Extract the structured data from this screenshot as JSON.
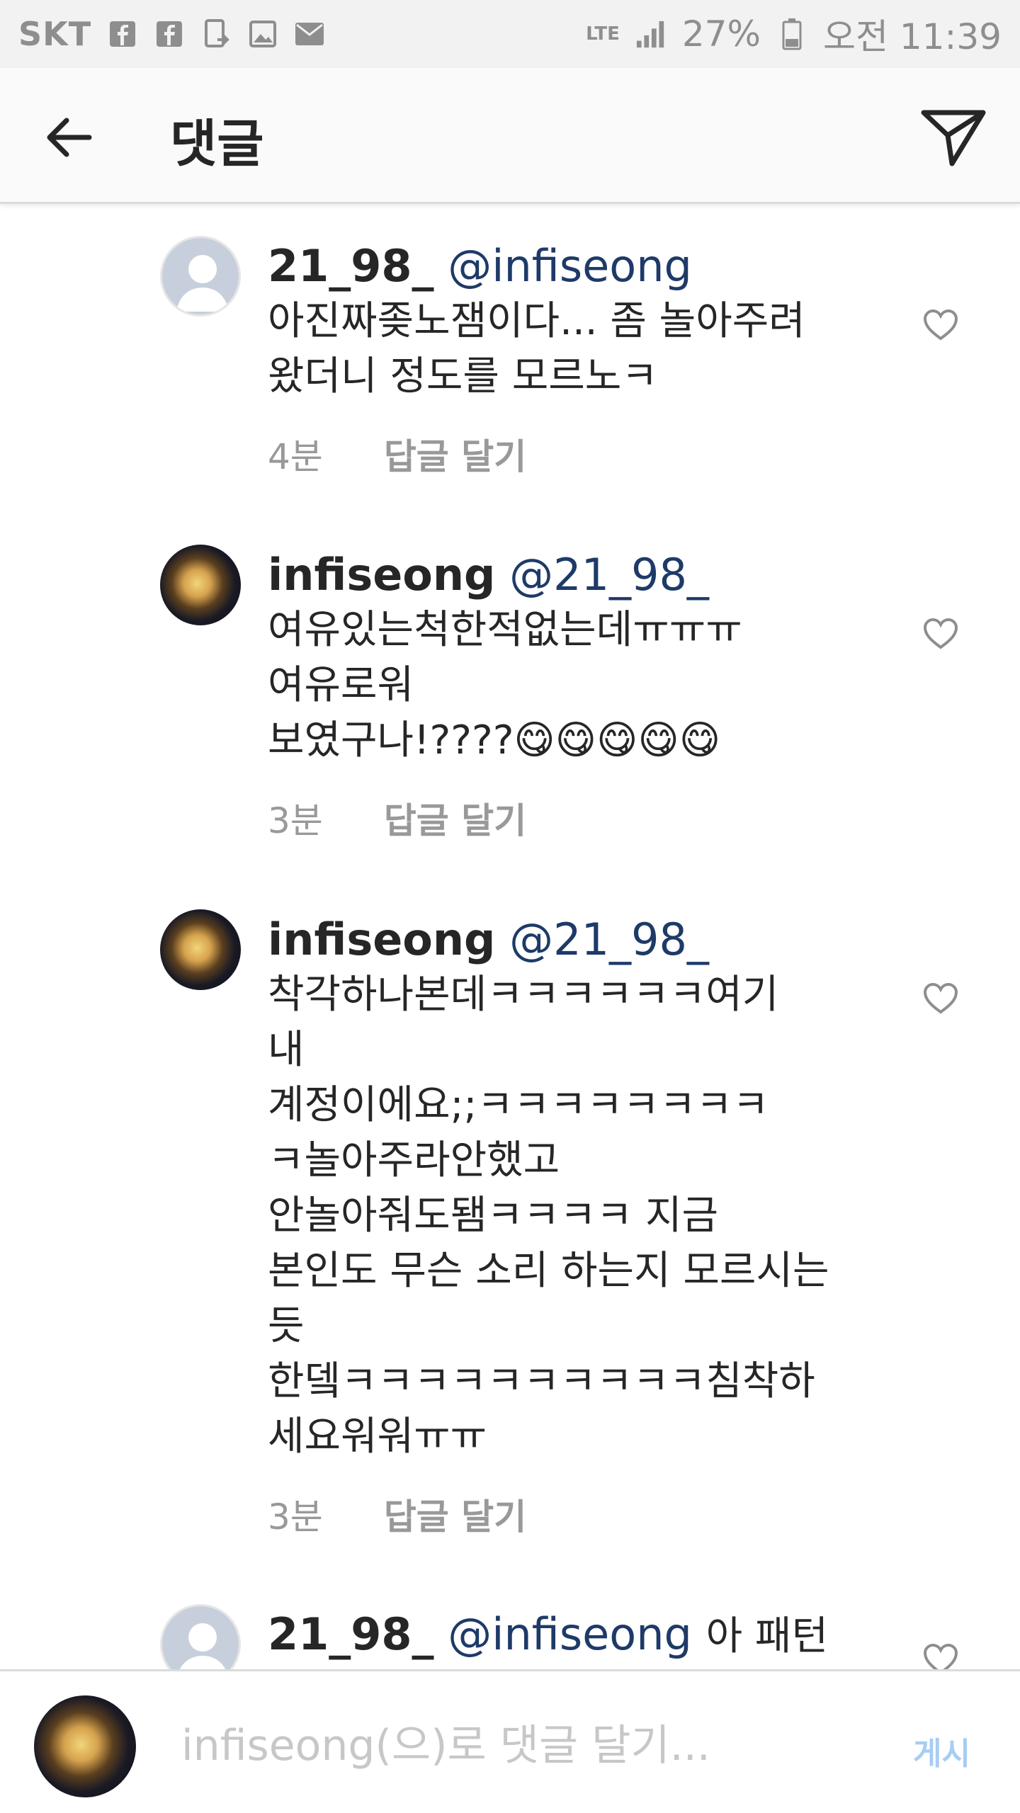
{
  "status_bar": {
    "carrier": "SKT",
    "network": "LTE",
    "battery": "27%",
    "time": "오전 11:39",
    "icons": [
      "facebook-icon",
      "facebook-icon",
      "phone-transfer-icon",
      "image-icon",
      "mail-icon",
      "signal-icon",
      "battery-icon"
    ]
  },
  "header": {
    "title": "댓글",
    "back_icon": "arrow-left-icon",
    "share_icon": "paper-plane-icon"
  },
  "comments": [
    {
      "username": "21_98_",
      "mention": "@infiseong",
      "text": "아진짜좆노잼이다... 좀 놀아주려\n왔더니 정도를 모르노ㅋ",
      "time": "4분",
      "reply_label": "답글 달기",
      "avatar": "default"
    },
    {
      "username": "infiseong",
      "mention": "@21_98_",
      "text": "여유있는척한적없는데ㅠㅠㅠ\n여유로워\n보였구나!????😋😋😋😋😋",
      "time": "3분",
      "reply_label": "답글 달기",
      "avatar": "photo"
    },
    {
      "username": "infiseong",
      "mention": "@21_98_",
      "text": "착각하나본데ㅋㅋㅋㅋㅋㅋ여기\n내\n계정이에요;;ㅋㅋㅋㅋㅋㅋㅋㅋ\nㅋ놀아주라안했고\n안놀아줘도됌ㅋㅋㅋㅋ 지금\n본인도 무슨 소리 하는지 모르시는\n듯\n한뎈ㅋㅋㅋㅋㅋㅋㅋㅋㅋㅋ침착하\n세요워워ㅠㅠ",
      "time": "3분",
      "reply_label": "답글 달기",
      "avatar": "photo"
    },
    {
      "username": "21_98_",
      "mention": "@infiseong",
      "text": "아 패턴",
      "time": "",
      "reply_label": "",
      "avatar": "default"
    }
  ],
  "composer": {
    "placeholder": "infiseong(으)로 댓글 달기...",
    "post_label": "게시"
  },
  "colors": {
    "mention": "#1e3a68",
    "muted": "#999999",
    "post_disabled": "#a8cdf3",
    "header_bg": "#fafafa",
    "status_bg": "#f2f2f2"
  }
}
